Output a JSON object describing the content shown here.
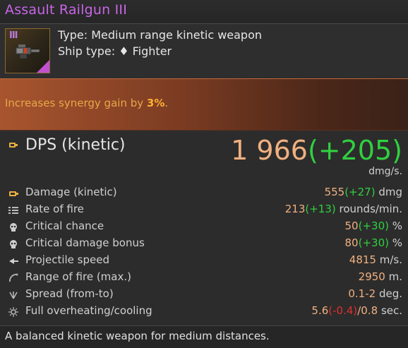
{
  "title": "Assault Railgun III",
  "icon": {
    "tier": "III",
    "name": "railgun-icon"
  },
  "header": {
    "type_line": "Type: Medium range kinetic weapon",
    "ship_type_label": "Ship type: ",
    "ship_type_value": "Fighter",
    "ship_type_icon": "diamond-icon"
  },
  "synergy": {
    "prefix": "Increases synergy gain by ",
    "value": "3%",
    "suffix": "."
  },
  "dps": {
    "label": "DPS (kinetic)",
    "value": "1 966",
    "bonus": "(+205)",
    "unit": "dmg/s."
  },
  "stats": [
    {
      "icon": "damage-icon",
      "label": "Damage (kinetic)",
      "value": "555",
      "bonus": "(+27)",
      "unit": " dmg"
    },
    {
      "icon": "rate-of-fire-icon",
      "label": "Rate of fire",
      "value": "213",
      "bonus": "(+13)",
      "unit": " rounds/min."
    },
    {
      "icon": "skull-icon",
      "label": "Critical chance",
      "value": "50",
      "bonus": "(+30)",
      "unit": " %"
    },
    {
      "icon": "skull-icon",
      "label": "Critical damage bonus",
      "value": "80",
      "bonus": "(+30)",
      "unit": " %"
    },
    {
      "icon": "speed-icon",
      "label": "Projectile speed",
      "value": "4815",
      "bonus": "",
      "unit": " m/s."
    },
    {
      "icon": "range-icon",
      "label": "Range of fire (max.)",
      "value": "2950",
      "bonus": "",
      "unit": " m."
    },
    {
      "icon": "spread-icon",
      "label": "Spread (from-to)",
      "value": "0.1-2",
      "bonus": "",
      "unit": " deg."
    },
    {
      "icon": "overheat-icon",
      "label": "Full overheating/cooling",
      "value": "5.6",
      "neg": "(-0.4)",
      "value2": "/0.8",
      "unit": " sec."
    }
  ],
  "footer": "A balanced kinetic weapon for medium distances.",
  "colors": {
    "title": "#c866e6",
    "bonus": "#30d040",
    "value": "#f0b080",
    "penalty": "#e03030",
    "synergy": "#e8a848"
  }
}
